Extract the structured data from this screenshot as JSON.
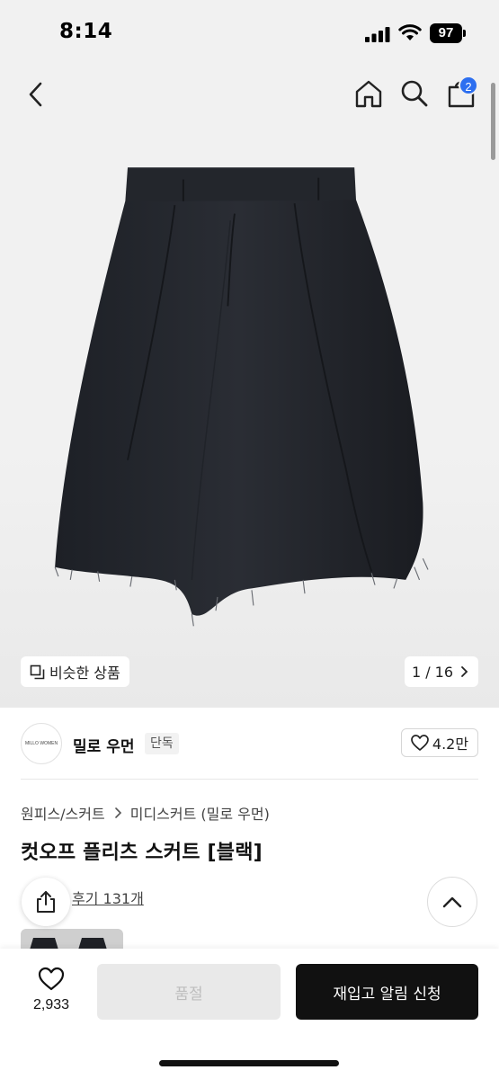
{
  "status_bar": {
    "time": "8:14",
    "battery": "97"
  },
  "nav": {
    "cart_count": "2"
  },
  "hero": {
    "similar_label": "비슷한 상품",
    "page_indicator": "1 / 16"
  },
  "brand": {
    "logo_text": "MILLO WOMEN",
    "name": "밀로 우먼",
    "tag": "단독",
    "likes": "4.2만"
  },
  "breadcrumb": {
    "category": "원피스/스커트",
    "subcategory": "미디스커트 (밀로 우먼)"
  },
  "product": {
    "title": "컷오프 플리츠 스커트 [블랙]",
    "reviews": "후기 131개"
  },
  "bottom_bar": {
    "wishlist_count": "2,933",
    "soldout_label": "품절",
    "restock_label": "재입고 알림 신청"
  },
  "colors": {
    "accent": "#2d6ff0",
    "primary_button": "#111111",
    "disabled_button": "#e9e9e9"
  }
}
